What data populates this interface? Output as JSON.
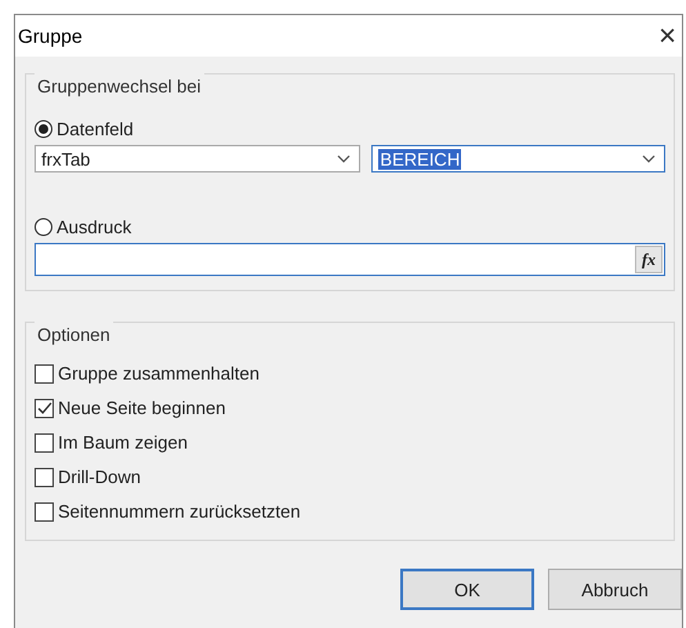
{
  "window": {
    "title": "Gruppe",
    "close": "×"
  },
  "group_change": {
    "legend": "Gruppenwechsel bei",
    "options": [
      {
        "kind": "datafield",
        "label": "Datenfeld",
        "selected": true,
        "dataset": {
          "value": "frxTab"
        },
        "field": {
          "value": "BEREICH",
          "highlighted": true
        }
      },
      {
        "kind": "expression",
        "label": "Ausdruck",
        "selected": false,
        "expression": {
          "button": "fx"
        }
      }
    ]
  },
  "options": {
    "legend": "Optionen",
    "items": [
      {
        "label": "Gruppe zusammenhalten",
        "checked": false
      },
      {
        "label": "Neue Seite beginnen",
        "checked": true
      },
      {
        "label": "Im Baum zeigen",
        "checked": false
      },
      {
        "label": "Drill-Down",
        "checked": false
      },
      {
        "label": "Seitennummern zurücksetzten",
        "checked": false
      }
    ]
  },
  "buttons": [
    {
      "label": "OK",
      "default": true
    },
    {
      "label": "Abbruch",
      "default": false
    }
  ]
}
